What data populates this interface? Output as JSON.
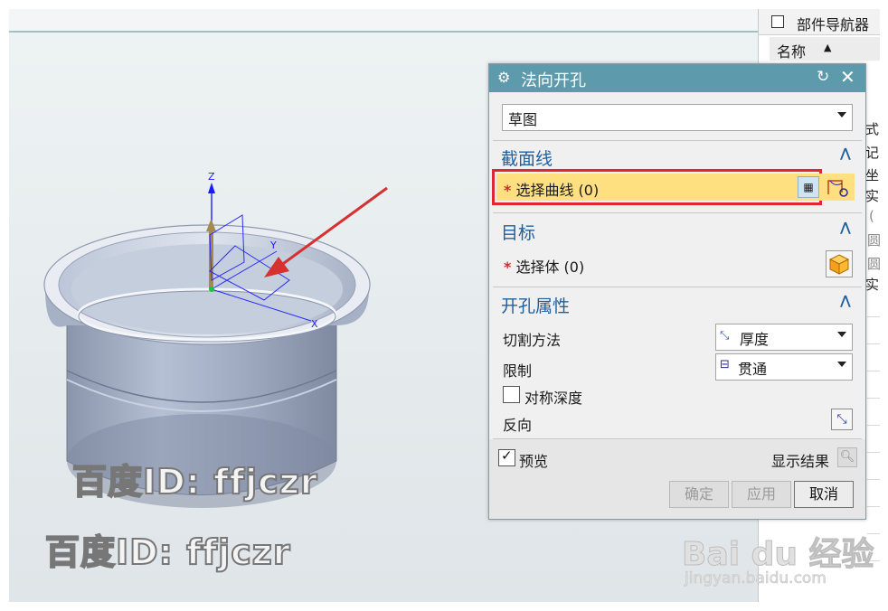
{
  "navigator": {
    "title": "部件导航器",
    "column_name": "名称",
    "fragments": [
      "式",
      "记",
      "坐",
      "实",
      "(",
      "圆",
      "圆",
      "实"
    ]
  },
  "dialog": {
    "title": "法向开孔",
    "type_value": "草图",
    "section_curve": {
      "title": "截面线",
      "select_label": "选择曲线 (0)"
    },
    "section_target": {
      "title": "目标",
      "select_label": "选择体 (0)"
    },
    "section_props": {
      "title": "开孔属性",
      "cut_method_label": "切割方法",
      "cut_method_value": "厚度",
      "limit_label": "限制",
      "limit_value": "贯通",
      "symmetric_label": "对称深度",
      "symmetric_checked": false,
      "reverse_label": "反向"
    },
    "preview_label": "预览",
    "preview_checked": true,
    "show_result_label": "显示结果",
    "ok_label": "确定",
    "apply_label": "应用",
    "cancel_label": "取消"
  },
  "axes": {
    "z": "Z",
    "y": "Y",
    "x": "X"
  },
  "watermark": {
    "text1": "百度ID: ffjczr",
    "text2": "百度ID: ffjczr",
    "baidu_logo": "Bai du 经验",
    "baidu_url": "jingyan.baidu.com"
  },
  "colors": {
    "dialog_title_bg": "#5d9aac",
    "highlight_row": "#ffe080",
    "highlight_border": "#e0262e",
    "arrow": "#d63030"
  }
}
